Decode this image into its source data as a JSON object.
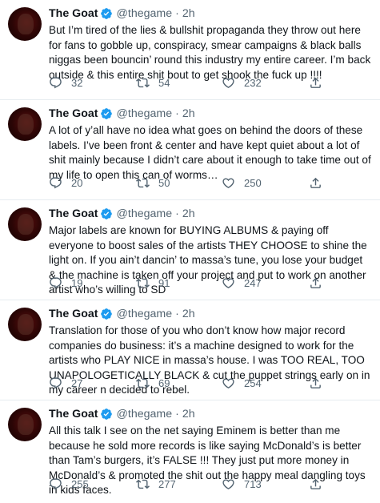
{
  "tweets": [
    {
      "name": "The Goat",
      "handle": "@thegame",
      "separator": "·",
      "time": "2h",
      "text": "But I’m tired of the lies & bullshit propaganda they throw out here for fans to gobble up, conspiracy, smear campaigns & black balls niggas been bouncin’ round this industry my entire career. I’m back outside & this entire shit bout to get shook the fuck up !!!!",
      "replies": "32",
      "retweets": "54",
      "likes": "232"
    },
    {
      "name": "The Goat",
      "handle": "@thegame",
      "separator": "·",
      "time": "2h",
      "text": "A lot of y’all have no idea what goes on behind the doors of these labels. I’ve been front & center and have kept quiet about a lot of shit mainly because I didn’t care about it enough to take time out of my life to open this can of worms…",
      "replies": "20",
      "retweets": "50",
      "likes": "250"
    },
    {
      "name": "The Goat",
      "handle": "@thegame",
      "separator": "·",
      "time": "2h",
      "text": "Major labels are known for BUYING ALBUMS & paying off everyone to boost sales of the artists THEY CHOOSE to shine the light on. If you ain’t dancin’ to massa’s tune, you lose your budget & the machine is taken off your project and put to work on another artist who’s willing to SD",
      "replies": "19",
      "retweets": "91",
      "likes": "247"
    },
    {
      "name": "The Goat",
      "handle": "@thegame",
      "separator": "·",
      "time": "2h",
      "text": "Translation for those of you who don’t know how major record companies do business: it’s a machine designed to work for the artists who PLAY NICE in massa’s house. I was TOO REAL, TOO UNAPOLOGETICALLY BLACK & cut the puppet strings early on in my career n decided to rebel.",
      "replies": "27",
      "retweets": "69",
      "likes": "254"
    },
    {
      "name": "The Goat",
      "handle": "@thegame",
      "separator": "·",
      "time": "2h",
      "text": "All this talk I see on the net saying Eminem is better than me because he sold more records is like saying McDonald’s is better than Tam’s burgers, it’s FALSE !!! They just put more money in McDonald’s & promoted the shit out the happy meal dangling toys in kids faces.",
      "replies": "255",
      "retweets": "277",
      "likes": "713"
    }
  ],
  "icons": {
    "avatar": "profile-photo",
    "verified": "verified-badge-icon",
    "reply": "reply-icon",
    "retweet": "retweet-icon",
    "like": "heart-icon",
    "share": "share-icon"
  },
  "colors": {
    "verified": "#1d9bf0",
    "secondary_text": "#536471",
    "divider": "#e6ecf0"
  }
}
